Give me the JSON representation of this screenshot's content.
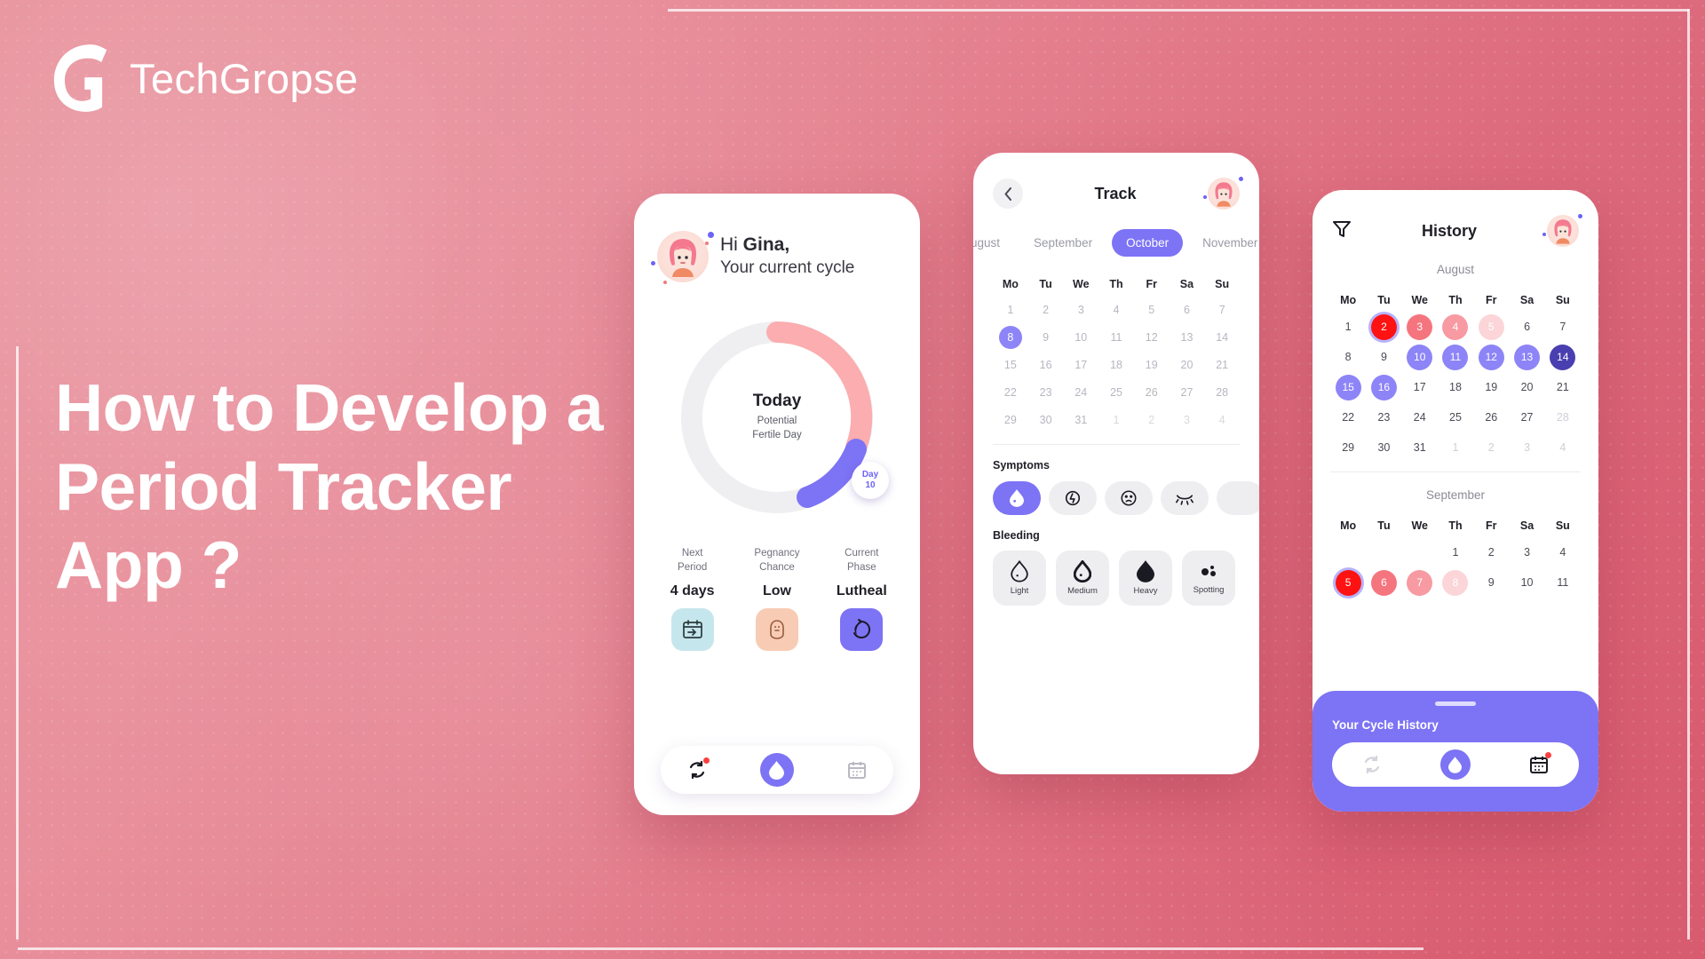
{
  "brand": {
    "name": "TechGropse",
    "logo_icon": "g-logo-icon"
  },
  "headline": "How to Develop a Period Tracker App ?",
  "colors": {
    "background_pink": "#e4808f",
    "accent_purple": "#7d73f5",
    "period_red": "#ff1212",
    "white": "#ffffff"
  },
  "phone1": {
    "greeting_line1_prefix": "Hi ",
    "greeting_name": "Gina,",
    "greeting_line2": "Your current cycle",
    "avatar_icon": "user-avatar-icon",
    "ring": {
      "today_label": "Today",
      "sub_line1": "Potential",
      "sub_line2": "Fertile Day",
      "day_badge_line1": "Day",
      "day_badge_line2": "10"
    },
    "stats": [
      {
        "label_line1": "Next",
        "label_line2": "Period",
        "value": "4 days",
        "icon": "calendar-next-icon"
      },
      {
        "label_line1": "Pegnancy",
        "label_line2": "Chance",
        "value": "Low",
        "icon": "baby-icon"
      },
      {
        "label_line1": "Current",
        "label_line2": "Phase",
        "value": "Lutheal",
        "icon": "cycle-phase-icon"
      }
    ],
    "nav": [
      {
        "icon": "cycle-icon",
        "active": false,
        "badge": true
      },
      {
        "icon": "droplet-icon",
        "active": true,
        "badge": false
      },
      {
        "icon": "calendar-icon",
        "active": false,
        "badge": false
      }
    ]
  },
  "phone2": {
    "back_icon": "chevron-left-icon",
    "title": "Track",
    "avatar_icon": "user-avatar-icon",
    "months": [
      {
        "label": "August",
        "active": false
      },
      {
        "label": "September",
        "active": false
      },
      {
        "label": "October",
        "active": true
      },
      {
        "label": "November",
        "active": false
      }
    ],
    "weekdays": [
      "Mo",
      "Tu",
      "We",
      "Th",
      "Fr",
      "Sa",
      "Su"
    ],
    "weeks": [
      [
        {
          "d": "1"
        },
        {
          "d": "2"
        },
        {
          "d": "3"
        },
        {
          "d": "4"
        },
        {
          "d": "5"
        },
        {
          "d": "6"
        },
        {
          "d": "7"
        }
      ],
      [
        {
          "d": "8",
          "selected": true
        },
        {
          "d": "9"
        },
        {
          "d": "10"
        },
        {
          "d": "11"
        },
        {
          "d": "12"
        },
        {
          "d": "13"
        },
        {
          "d": "14"
        }
      ],
      [
        {
          "d": "15"
        },
        {
          "d": "16"
        },
        {
          "d": "17"
        },
        {
          "d": "18"
        },
        {
          "d": "19"
        },
        {
          "d": "20"
        },
        {
          "d": "21"
        }
      ],
      [
        {
          "d": "22"
        },
        {
          "d": "23"
        },
        {
          "d": "24"
        },
        {
          "d": "25"
        },
        {
          "d": "26"
        },
        {
          "d": "27"
        },
        {
          "d": "28"
        }
      ],
      [
        {
          "d": "29"
        },
        {
          "d": "30"
        },
        {
          "d": "31"
        },
        {
          "d": "1",
          "muted": true
        },
        {
          "d": "2",
          "muted": true
        },
        {
          "d": "3",
          "muted": true
        },
        {
          "d": "4",
          "muted": true
        }
      ]
    ],
    "symptoms_title": "Symptoms",
    "symptoms": [
      {
        "icon": "droplet-icon",
        "active": true
      },
      {
        "icon": "energy-icon",
        "active": false
      },
      {
        "icon": "sad-face-icon",
        "active": false
      },
      {
        "icon": "sleepy-eye-icon",
        "active": false
      },
      {
        "icon": "more-symptom-icon",
        "active": false
      }
    ],
    "bleeding_title": "Bleeding",
    "bleeding": [
      {
        "label": "Light",
        "icon": "droplet-light-icon"
      },
      {
        "label": "Medium",
        "icon": "droplet-medium-icon"
      },
      {
        "label": "Heavy",
        "icon": "droplet-heavy-icon"
      },
      {
        "label": "Spotting",
        "icon": "spotting-icon"
      }
    ]
  },
  "phone3": {
    "filter_icon": "filter-icon",
    "title": "History",
    "avatar_icon": "user-avatar-icon",
    "weekdays": [
      "Mo",
      "Tu",
      "We",
      "Th",
      "Fr",
      "Sa",
      "Su"
    ],
    "month1_label": "August",
    "month1_weeks": [
      [
        {
          "d": "1"
        },
        {
          "d": "2",
          "fill": "#ff1212",
          "today": true
        },
        {
          "d": "3",
          "fill": "#f5757f"
        },
        {
          "d": "4",
          "fill": "#f79aa2"
        },
        {
          "d": "5",
          "fill": "#fbd5d8"
        },
        {
          "d": "6"
        },
        {
          "d": "7"
        }
      ],
      [
        {
          "d": "8"
        },
        {
          "d": "9"
        },
        {
          "d": "10",
          "fill": "#8d84f7"
        },
        {
          "d": "11",
          "fill": "#8d84f7"
        },
        {
          "d": "12",
          "fill": "#8d84f7"
        },
        {
          "d": "13",
          "fill": "#8d84f7"
        },
        {
          "d": "14",
          "fill": "#4a3fb0"
        }
      ],
      [
        {
          "d": "15",
          "fill": "#8d84f7"
        },
        {
          "d": "16",
          "fill": "#8d84f7"
        },
        {
          "d": "17"
        },
        {
          "d": "18"
        },
        {
          "d": "19"
        },
        {
          "d": "20"
        },
        {
          "d": "21"
        }
      ],
      [
        {
          "d": "22"
        },
        {
          "d": "23"
        },
        {
          "d": "24"
        },
        {
          "d": "25"
        },
        {
          "d": "26"
        },
        {
          "d": "27"
        },
        {
          "d": "28",
          "muted": true
        }
      ],
      [
        {
          "d": "29"
        },
        {
          "d": "30"
        },
        {
          "d": "31"
        },
        {
          "d": "1",
          "muted": true
        },
        {
          "d": "2",
          "muted": true
        },
        {
          "d": "3",
          "muted": true
        },
        {
          "d": "4",
          "muted": true
        }
      ]
    ],
    "month2_label": "September",
    "month2_weeks": [
      [
        {
          "d": ""
        },
        {
          "d": ""
        },
        {
          "d": ""
        },
        {
          "d": "1"
        },
        {
          "d": "2"
        },
        {
          "d": "3"
        },
        {
          "d": "4"
        }
      ],
      [
        {
          "d": "5",
          "fill": "#ff1212",
          "today": true
        },
        {
          "d": "6",
          "fill": "#f5757f"
        },
        {
          "d": "7",
          "fill": "#f79aa2"
        },
        {
          "d": "8",
          "fill": "#fbd5d8"
        },
        {
          "d": "9"
        },
        {
          "d": "10"
        },
        {
          "d": "11"
        }
      ]
    ],
    "cycle_panel_title": "Your Cycle History",
    "nav": [
      {
        "icon": "cycle-icon",
        "active": false,
        "badge": false
      },
      {
        "icon": "droplet-icon",
        "active": true,
        "badge": false
      },
      {
        "icon": "calendar-icon",
        "active": false,
        "badge": true
      }
    ]
  }
}
